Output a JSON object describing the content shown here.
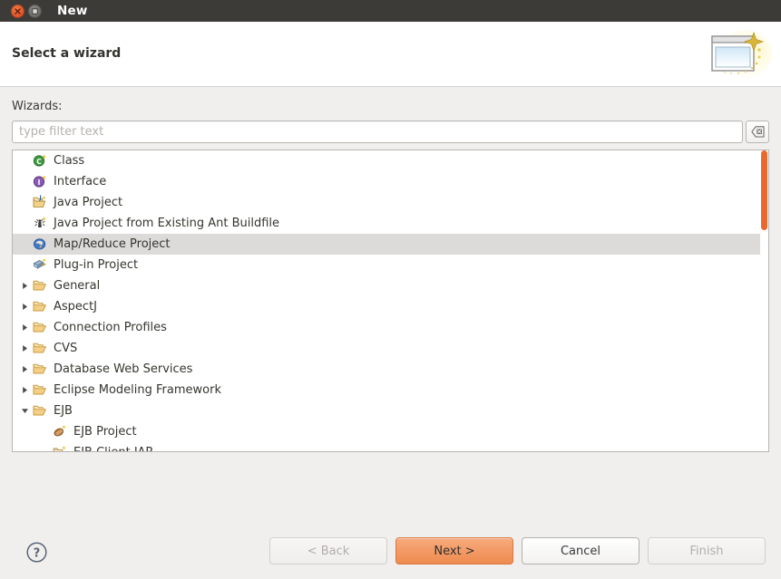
{
  "window": {
    "title": "New",
    "close_icon": "close-icon",
    "maximize_icon": "maximize-icon"
  },
  "header": {
    "heading": "Select a wizard",
    "banner_icon": "wizard-sparkle-icon"
  },
  "form": {
    "wizards_label": "Wizards:",
    "filter_placeholder": "type filter text",
    "filter_value": "",
    "clear_icon": "clear-field-icon"
  },
  "tree": {
    "selected_label": "Map/Reduce Project",
    "items": [
      {
        "label": "Class",
        "icon": "java-class-icon",
        "twisty": "none",
        "indent": 0,
        "selected": false
      },
      {
        "label": "Interface",
        "icon": "java-interface-icon",
        "twisty": "none",
        "indent": 0,
        "selected": false
      },
      {
        "label": "Java Project",
        "icon": "java-project-icon",
        "twisty": "none",
        "indent": 0,
        "selected": false
      },
      {
        "label": "Java Project from Existing Ant Buildfile",
        "icon": "ant-buildfile-icon",
        "twisty": "none",
        "indent": 0,
        "selected": false
      },
      {
        "label": "Map/Reduce Project",
        "icon": "hadoop-elephant-icon",
        "twisty": "none",
        "indent": 0,
        "selected": true
      },
      {
        "label": "Plug-in Project",
        "icon": "plugin-project-icon",
        "twisty": "none",
        "indent": 0,
        "selected": false
      },
      {
        "label": "General",
        "icon": "folder-icon",
        "twisty": "collapsed",
        "indent": 0,
        "selected": false
      },
      {
        "label": "AspectJ",
        "icon": "folder-icon",
        "twisty": "collapsed",
        "indent": 0,
        "selected": false
      },
      {
        "label": "Connection Profiles",
        "icon": "folder-icon",
        "twisty": "collapsed",
        "indent": 0,
        "selected": false
      },
      {
        "label": "CVS",
        "icon": "folder-icon",
        "twisty": "collapsed",
        "indent": 0,
        "selected": false
      },
      {
        "label": "Database Web Services",
        "icon": "folder-icon",
        "twisty": "collapsed",
        "indent": 0,
        "selected": false
      },
      {
        "label": "Eclipse Modeling Framework",
        "icon": "folder-icon",
        "twisty": "collapsed",
        "indent": 0,
        "selected": false
      },
      {
        "label": "EJB",
        "icon": "folder-icon",
        "twisty": "expanded",
        "indent": 0,
        "selected": false
      },
      {
        "label": "EJB Project",
        "icon": "ejb-project-icon",
        "twisty": "none",
        "indent": 1,
        "selected": false
      },
      {
        "label": "EJB Client JAR",
        "icon": "ejb-jar-icon",
        "twisty": "none",
        "indent": 1,
        "selected": false
      }
    ]
  },
  "scrollbar": {
    "thumb_color": "#e9682c"
  },
  "footer": {
    "help_icon": "help-icon",
    "buttons": [
      {
        "label": "< Back",
        "state": "disabled",
        "name": "back-button"
      },
      {
        "label": "Next >",
        "state": "default",
        "name": "next-button"
      },
      {
        "label": "Cancel",
        "state": "enabled",
        "name": "cancel-button"
      },
      {
        "label": "Finish",
        "state": "disabled",
        "name": "finish-button"
      }
    ]
  },
  "colors": {
    "titlebar": "#3c3b37",
    "accent_orange": "#ef8b50",
    "selection": "#dcdbd9",
    "panel": "#f0efee"
  }
}
